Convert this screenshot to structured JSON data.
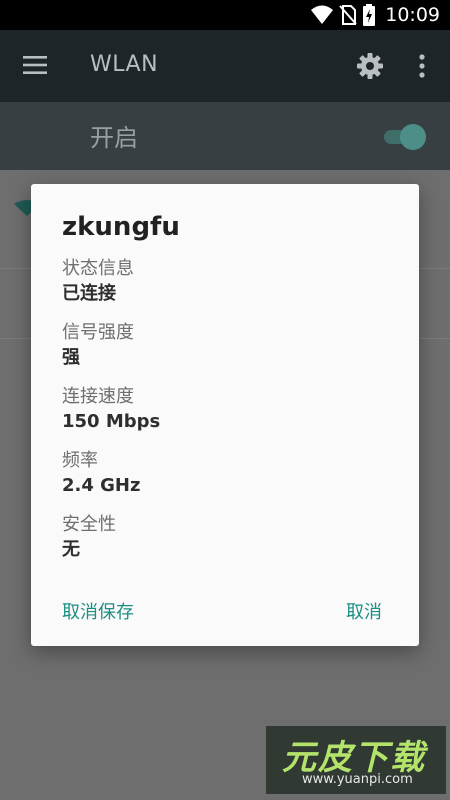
{
  "status_bar": {
    "time": "10:09",
    "icons": [
      "wifi-icon",
      "no-sim-icon",
      "battery-charging-icon"
    ]
  },
  "app_bar": {
    "title": "WLAN",
    "icons": [
      "menu-icon",
      "gear-icon",
      "overflow-menu-icon"
    ]
  },
  "wifi_switch": {
    "label": "开启",
    "state": "on"
  },
  "dialog": {
    "title": "zkungfu",
    "items": [
      {
        "label": "状态信息",
        "value": "已连接"
      },
      {
        "label": "信号强度",
        "value": "强"
      },
      {
        "label": "连接速度",
        "value": "150 Mbps"
      },
      {
        "label": "频率",
        "value": "2.4 GHz"
      },
      {
        "label": "安全性",
        "value": "无"
      }
    ],
    "forget_button": "取消保存",
    "cancel_button": "取消"
  },
  "watermark": {
    "brand": "元皮下载",
    "url": "www.yuanpi.com"
  },
  "colors": {
    "accent": "#1d8e84",
    "appbar": "#1d2528",
    "switchbar": "#383f42",
    "dialog_bg": "#fafafa"
  }
}
